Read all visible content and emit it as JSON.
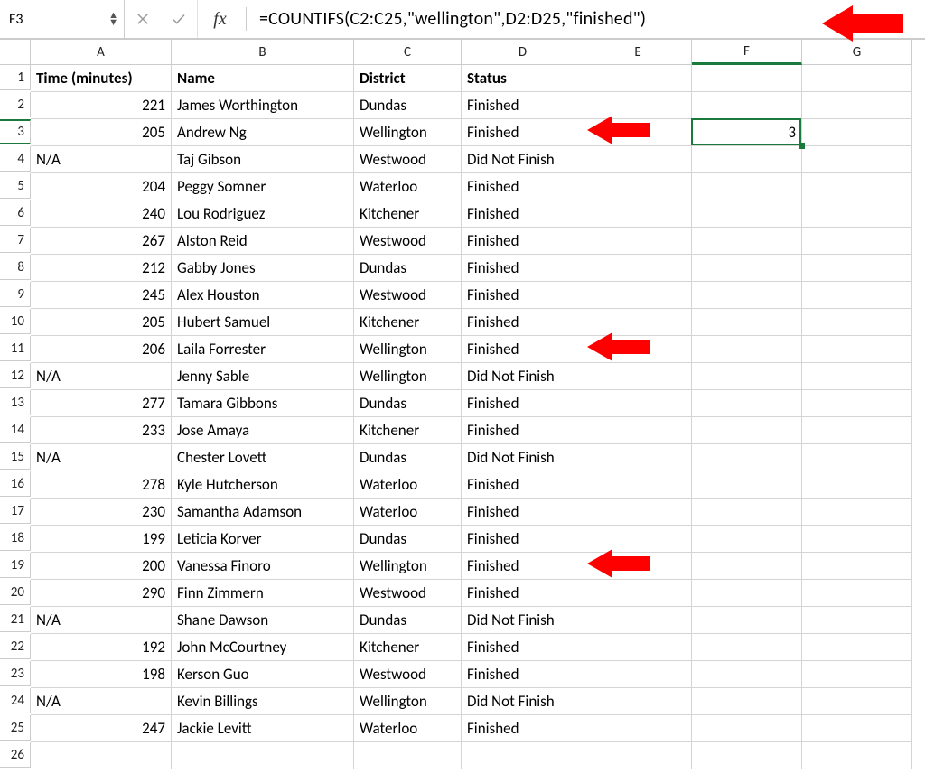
{
  "nameBox": "F3",
  "fxLabel": "fx",
  "formula": "=COUNTIFS(C2:C25,\"wellington\",D2:D25,\"finished\")",
  "columns": [
    "A",
    "B",
    "C",
    "D",
    "E",
    "F",
    "G"
  ],
  "rowCount": 26,
  "headers": {
    "A": "Time (minutes)",
    "B": "Name",
    "C": "District",
    "D": "Status"
  },
  "selectedCell": {
    "col": "F",
    "row": 3,
    "value": "3"
  },
  "rows": [
    {
      "r": 2,
      "A": "221",
      "B": "James Worthington",
      "C": "Dundas",
      "D": "Finished"
    },
    {
      "r": 3,
      "A": "205",
      "B": "Andrew Ng",
      "C": "Wellington",
      "D": "Finished"
    },
    {
      "r": 4,
      "A": "N/A",
      "B": "Taj Gibson",
      "C": "Westwood",
      "D": "Did Not Finish",
      "naLeft": true
    },
    {
      "r": 5,
      "A": "204",
      "B": "Peggy Somner",
      "C": "Waterloo",
      "D": "Finished"
    },
    {
      "r": 6,
      "A": "240",
      "B": "Lou Rodriguez",
      "C": "Kitchener",
      "D": "Finished"
    },
    {
      "r": 7,
      "A": "267",
      "B": "Alston Reid",
      "C": "Westwood",
      "D": "Finished"
    },
    {
      "r": 8,
      "A": "212",
      "B": "Gabby Jones",
      "C": "Dundas",
      "D": "Finished"
    },
    {
      "r": 9,
      "A": "245",
      "B": "Alex Houston",
      "C": "Westwood",
      "D": "Finished"
    },
    {
      "r": 10,
      "A": "205",
      "B": "Hubert Samuel",
      "C": "Kitchener",
      "D": "Finished"
    },
    {
      "r": 11,
      "A": "206",
      "B": "Laila Forrester",
      "C": "Wellington",
      "D": "Finished"
    },
    {
      "r": 12,
      "A": "N/A",
      "B": "Jenny Sable",
      "C": "Wellington",
      "D": "Did Not Finish",
      "naLeft": true
    },
    {
      "r": 13,
      "A": "277",
      "B": "Tamara Gibbons",
      "C": "Dundas",
      "D": "Finished"
    },
    {
      "r": 14,
      "A": "233",
      "B": "Jose Amaya",
      "C": "Kitchener",
      "D": "Finished"
    },
    {
      "r": 15,
      "A": "N/A",
      "B": "Chester Lovett",
      "C": "Dundas",
      "D": "Did Not Finish",
      "naLeft": true
    },
    {
      "r": 16,
      "A": "278",
      "B": "Kyle Hutcherson",
      "C": "Waterloo",
      "D": "Finished"
    },
    {
      "r": 17,
      "A": "230",
      "B": "Samantha Adamson",
      "C": "Waterloo",
      "D": "Finished"
    },
    {
      "r": 18,
      "A": "199",
      "B": "Leticia Korver",
      "C": "Dundas",
      "D": "Finished"
    },
    {
      "r": 19,
      "A": "200",
      "B": "Vanessa Finoro",
      "C": "Wellington",
      "D": "Finished"
    },
    {
      "r": 20,
      "A": "290",
      "B": "Finn Zimmern",
      "C": "Westwood",
      "D": "Finished"
    },
    {
      "r": 21,
      "A": "N/A",
      "B": "Shane Dawson",
      "C": "Dundas",
      "D": "Did Not Finish",
      "naLeft": true
    },
    {
      "r": 22,
      "A": "192",
      "B": "John McCourtney",
      "C": "Kitchener",
      "D": "Finished"
    },
    {
      "r": 23,
      "A": "198",
      "B": "Kerson Guo",
      "C": "Westwood",
      "D": "Finished"
    },
    {
      "r": 24,
      "A": "N/A",
      "B": "Kevin Billings",
      "C": "Wellington",
      "D": "Did Not Finish",
      "naLeft": true
    },
    {
      "r": 25,
      "A": "247",
      "B": "Jackie Levitt",
      "C": "Waterloo",
      "D": "Finished"
    }
  ],
  "arrowRows": [
    3,
    11,
    19
  ],
  "icons": {
    "stepUp": "▲",
    "stepDown": "▼"
  }
}
